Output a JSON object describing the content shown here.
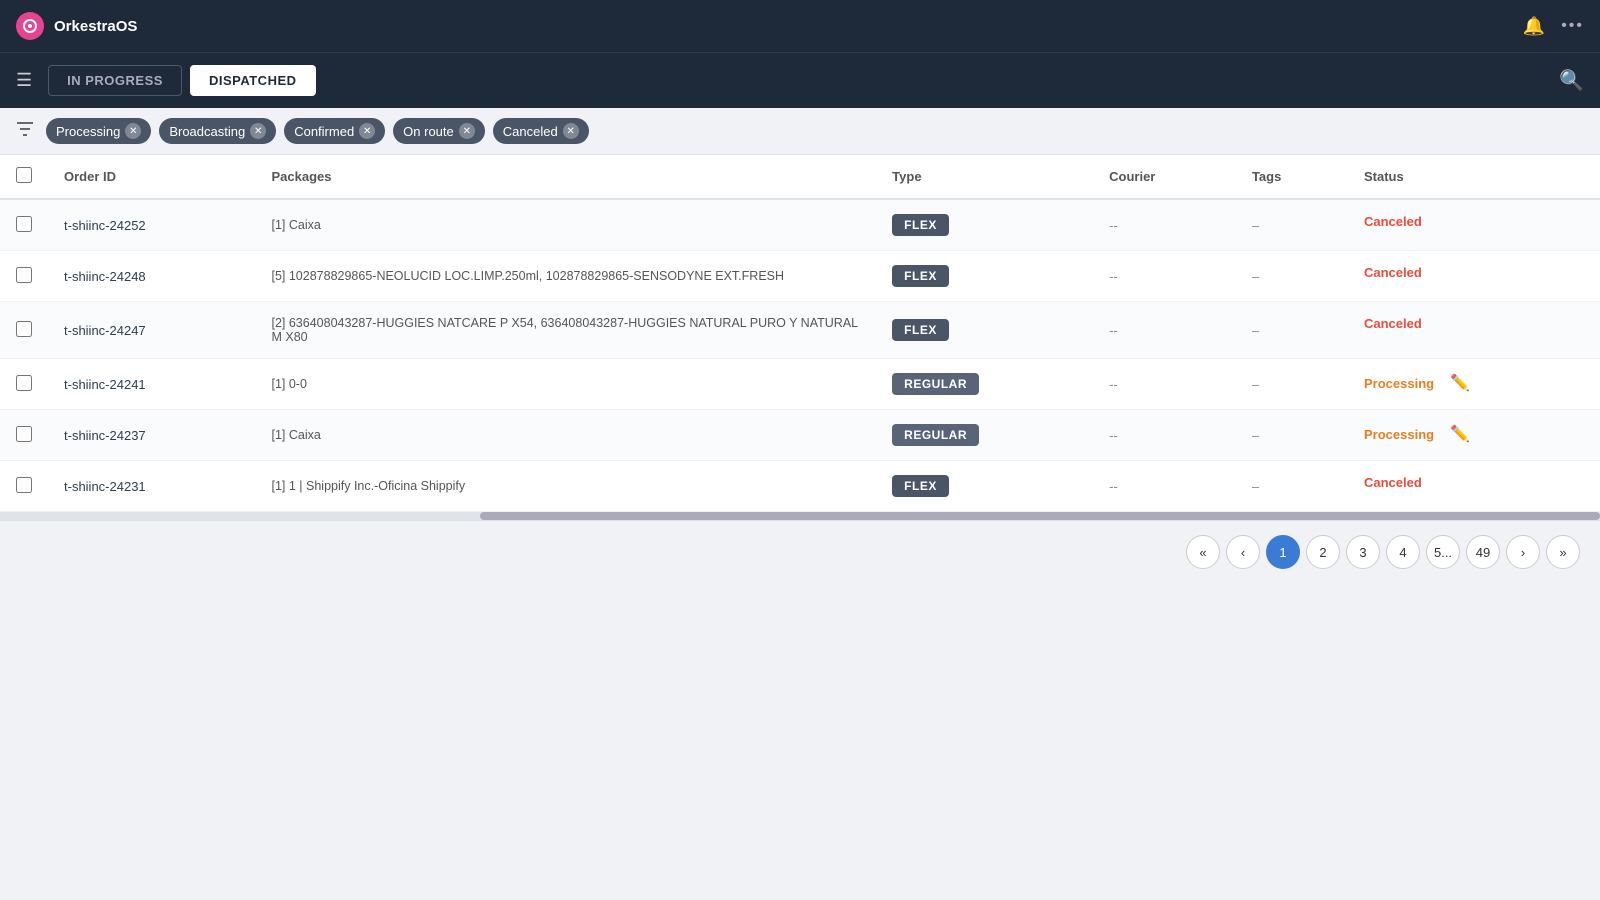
{
  "app": {
    "title": "OrkestraOS",
    "logo_letter": "O"
  },
  "nav": {
    "bell_icon": "🔔",
    "more_icon": "···",
    "search_icon": "🔍"
  },
  "toolbar": {
    "menu_icon": "☰",
    "tabs": [
      {
        "id": "in-progress",
        "label": "IN PROGRESS",
        "active": false
      },
      {
        "id": "dispatched",
        "label": "DISPATCHED",
        "active": true
      }
    ]
  },
  "filters": {
    "icon": "⚗",
    "chips": [
      {
        "id": "processing",
        "label": "Processing"
      },
      {
        "id": "broadcasting",
        "label": "Broadcasting"
      },
      {
        "id": "confirmed",
        "label": "Confirmed"
      },
      {
        "id": "on-route",
        "label": "On route"
      },
      {
        "id": "canceled",
        "label": "Canceled"
      }
    ]
  },
  "table": {
    "columns": [
      "Order ID",
      "Packages",
      "Type",
      "Courier",
      "Tags",
      "Status"
    ],
    "rows": [
      {
        "id": "t-shiinc-24252",
        "packages": "[1] Caixa",
        "type": "FLEX",
        "courier": "--",
        "tags": "–",
        "status": "Canceled",
        "status_class": "status-canceled",
        "has_action": false
      },
      {
        "id": "t-shiinc-24248",
        "packages": "[5] 102878829865-NEOLUCID LOC.LIMP.250ml, 102878829865-SENSODYNE EXT.FRESH",
        "type": "FLEX",
        "courier": "--",
        "tags": "–",
        "status": "Canceled",
        "status_class": "status-canceled",
        "has_action": false
      },
      {
        "id": "t-shiinc-24247",
        "packages": "[2] 636408043287-HUGGIES NATCARE P X54, 636408043287-HUGGIES NATURAL PURO Y NATURAL M X80",
        "type": "FLEX",
        "courier": "--",
        "tags": "–",
        "status": "Canceled",
        "status_class": "status-canceled",
        "has_action": false
      },
      {
        "id": "t-shiinc-24241",
        "packages": "[1] 0-0",
        "type": "REGULAR",
        "type_class": "regular",
        "courier": "--",
        "tags": "–",
        "status": "Processing",
        "status_class": "status-processing",
        "has_action": true
      },
      {
        "id": "t-shiinc-24237",
        "packages": "[1] Caixa",
        "type": "REGULAR",
        "type_class": "regular",
        "courier": "--",
        "tags": "–",
        "status": "Processing",
        "status_class": "status-processing",
        "has_action": true
      },
      {
        "id": "t-shiinc-24231",
        "packages": "[1] 1 | Shippify Inc.-Oficina Shippify",
        "type": "FLEX",
        "courier": "--",
        "tags": "–",
        "status": "Canceled",
        "status_class": "status-canceled",
        "has_action": false
      }
    ]
  },
  "pagination": {
    "pages": [
      "1",
      "2",
      "3",
      "4",
      "5...",
      "49"
    ],
    "current": "1",
    "first_label": "«",
    "prev_label": "‹",
    "next_label": "›",
    "last_label": "»"
  }
}
